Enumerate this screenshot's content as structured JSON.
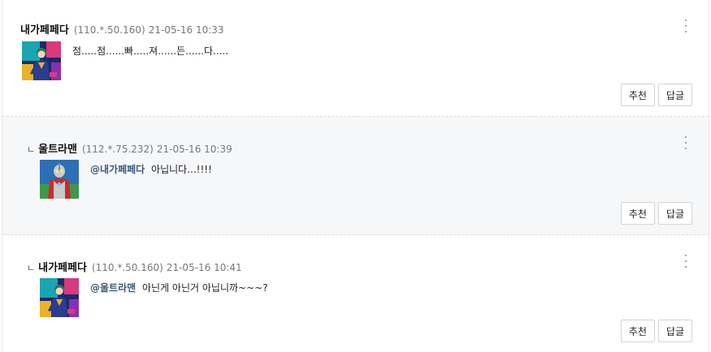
{
  "comments": [
    {
      "is_reply": false,
      "nickname": "내가페페다",
      "ip": "(110.*.50.160)",
      "date": "21-05-16 10:33",
      "mention": "",
      "text": "점.....점......빠.....져......든......다.....",
      "recommend_label": "추천",
      "reply_label": "답글",
      "avatar_icon": "joker-avatar"
    },
    {
      "is_reply": true,
      "reply_marker": "ㄴ",
      "nickname": "울트라맨",
      "ip": "(112.*.75.232)",
      "date": "21-05-16 10:39",
      "mention": "@내가페페다",
      "text": "아닙니다...!!!!",
      "recommend_label": "추천",
      "reply_label": "답글",
      "avatar_icon": "ultraman-avatar"
    },
    {
      "is_reply": true,
      "reply_marker": "ㄴ",
      "nickname": "내가페페다",
      "ip": "(110.*.50.160)",
      "date": "21-05-16 10:41",
      "mention": "@울트라맨",
      "text": "아닌게 아닌거 아닙니까~~~?",
      "recommend_label": "추천",
      "reply_label": "답글",
      "avatar_icon": "joker-avatar"
    }
  ],
  "colors": {
    "mention": "#3a5a7a",
    "reply_background": "#f6f7f9",
    "border": "#dcdcdc"
  }
}
